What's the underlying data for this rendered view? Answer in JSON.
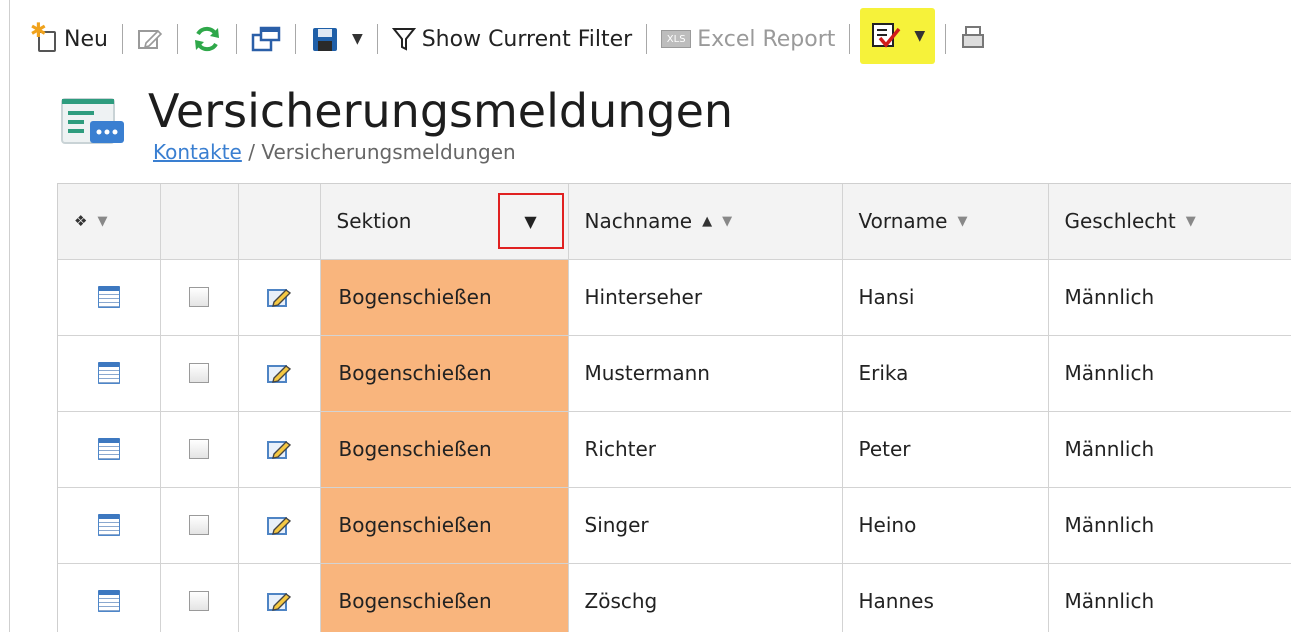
{
  "toolbar": {
    "new_label": "Neu",
    "filter_label": "Show Current Filter",
    "excel_label": "Excel Report",
    "xls_tag": "XLS",
    "caret": "▼",
    "highlight_color": "#f6f23a"
  },
  "page": {
    "title": "Versicherungsmeldungen",
    "breadcrumb": {
      "parent": "Kontakte",
      "separator": " / ",
      "current": "Versicherungsmeldungen"
    }
  },
  "grid": {
    "columns": [
      {
        "key": "select",
        "label": ""
      },
      {
        "key": "check",
        "label": ""
      },
      {
        "key": "edit",
        "label": ""
      },
      {
        "key": "sektion",
        "label": "Sektion",
        "filter_active": true
      },
      {
        "key": "nachname",
        "label": "Nachname",
        "sorted": "ascending"
      },
      {
        "key": "vorname",
        "label": "Vorname"
      },
      {
        "key": "geschlecht",
        "label": "Geschlecht"
      }
    ],
    "sort_icon": "▲",
    "filter_icon": "▼",
    "sektion_highlight_color": "#f9b57d",
    "rows": [
      {
        "sektion": "Bogenschießen",
        "nachname": "Hinterseher",
        "vorname": "Hansi",
        "geschlecht": "Männlich"
      },
      {
        "sektion": "Bogenschießen",
        "nachname": "Mustermann",
        "vorname": "Erika",
        "geschlecht": "Männlich"
      },
      {
        "sektion": "Bogenschießen",
        "nachname": "Richter",
        "vorname": "Peter",
        "geschlecht": "Männlich"
      },
      {
        "sektion": "Bogenschießen",
        "nachname": "Singer",
        "vorname": "Heino",
        "geschlecht": "Männlich"
      },
      {
        "sektion": "Bogenschießen",
        "nachname": "Zöschg",
        "vorname": "Hannes",
        "geschlecht": "Männlich"
      }
    ]
  }
}
